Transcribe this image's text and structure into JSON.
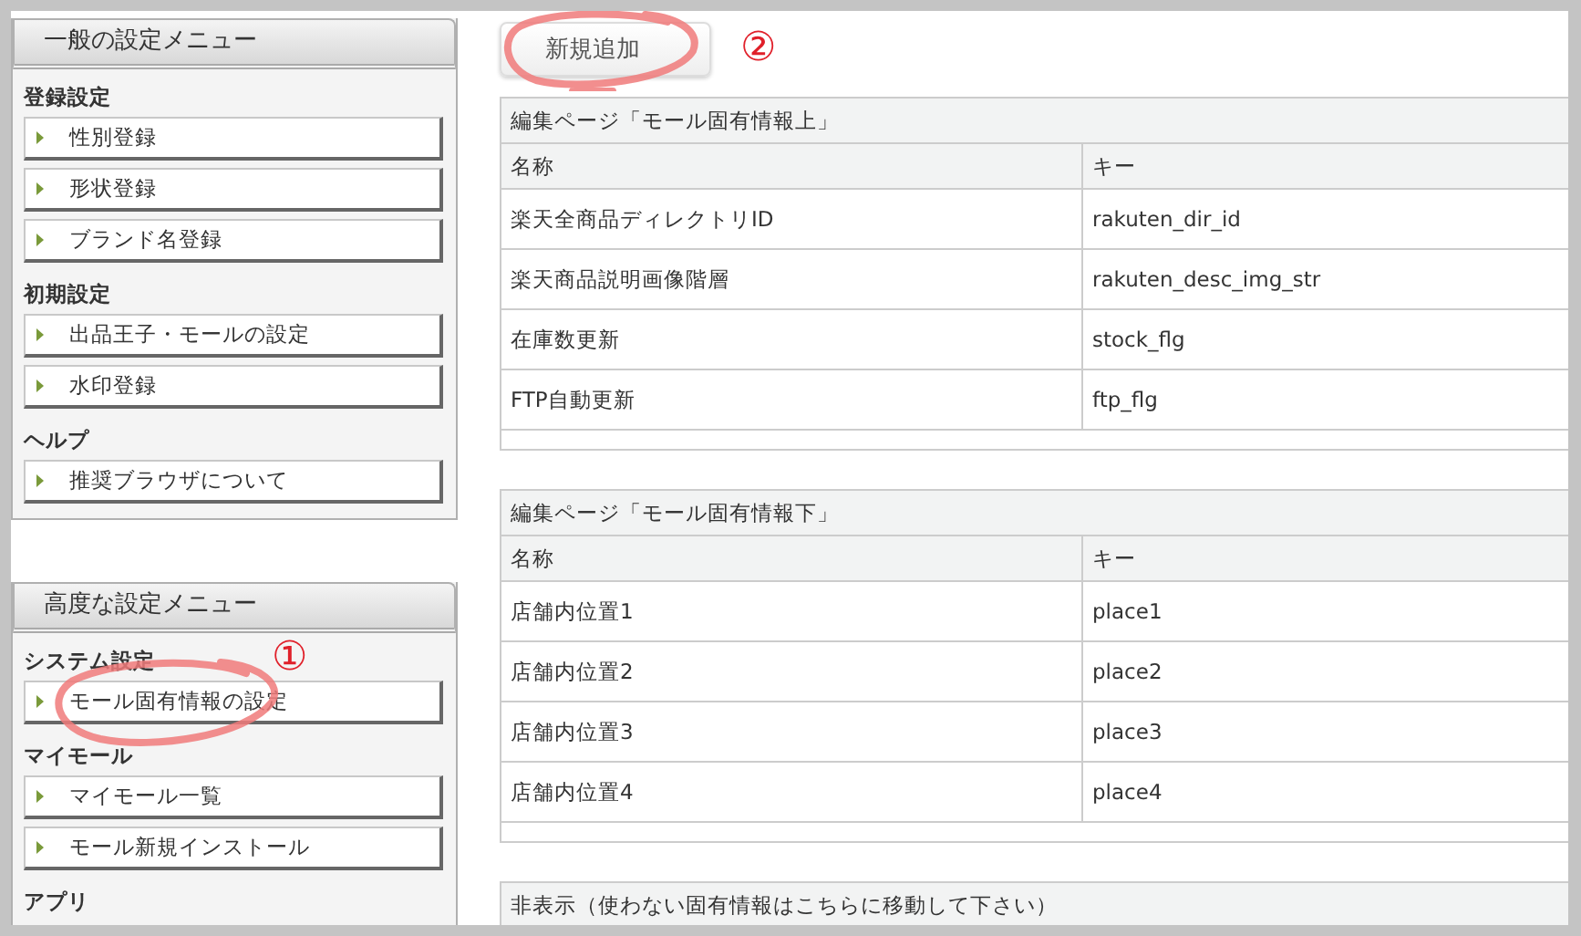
{
  "sidebar": {
    "panels": [
      {
        "title": "一般の設定メニュー",
        "groups": [
          {
            "heading": "登録設定",
            "items": [
              {
                "label": "性別登録"
              },
              {
                "label": "形状登録"
              },
              {
                "label": "ブランド名登録"
              }
            ]
          },
          {
            "heading": "初期設定",
            "items": [
              {
                "label": "出品王子・モールの設定"
              },
              {
                "label": "水印登録"
              }
            ]
          },
          {
            "heading": "ヘルプ",
            "items": [
              {
                "label": "推奨ブラウザについて"
              }
            ]
          }
        ]
      },
      {
        "title": "高度な設定メニュー",
        "groups": [
          {
            "heading": "システム設定",
            "items": [
              {
                "label": "モール固有情報の設定",
                "annotated": true,
                "marker": "①"
              }
            ]
          },
          {
            "heading": "マイモール",
            "items": [
              {
                "label": "マイモール一覧"
              },
              {
                "label": "モール新規インストール"
              }
            ]
          },
          {
            "heading": "アプリ"
          }
        ]
      }
    ]
  },
  "add_button": {
    "label": "新規追加",
    "annotated": true,
    "marker": "②"
  },
  "sections": [
    {
      "title": "編集ページ「モール固有情報上」",
      "columns": [
        "名称",
        "キー"
      ],
      "rows": [
        [
          "楽天全商品ディレクトリID",
          "rakuten_dir_id"
        ],
        [
          "楽天商品説明画像階層",
          "rakuten_desc_img_str"
        ],
        [
          "在庫数更新",
          "stock_flg"
        ],
        [
          "FTP自動更新",
          "ftp_flg"
        ]
      ]
    },
    {
      "title": "編集ページ「モール固有情報下」",
      "columns": [
        "名称",
        "キー"
      ],
      "rows": [
        [
          "店舗内位置1",
          "place1"
        ],
        [
          "店舗内位置2",
          "place2"
        ],
        [
          "店舗内位置3",
          "place3"
        ],
        [
          "店舗内位置4",
          "place4"
        ]
      ]
    },
    {
      "title": "非表示（使わない固有情報はこちらに移動して下さい）"
    }
  ]
}
